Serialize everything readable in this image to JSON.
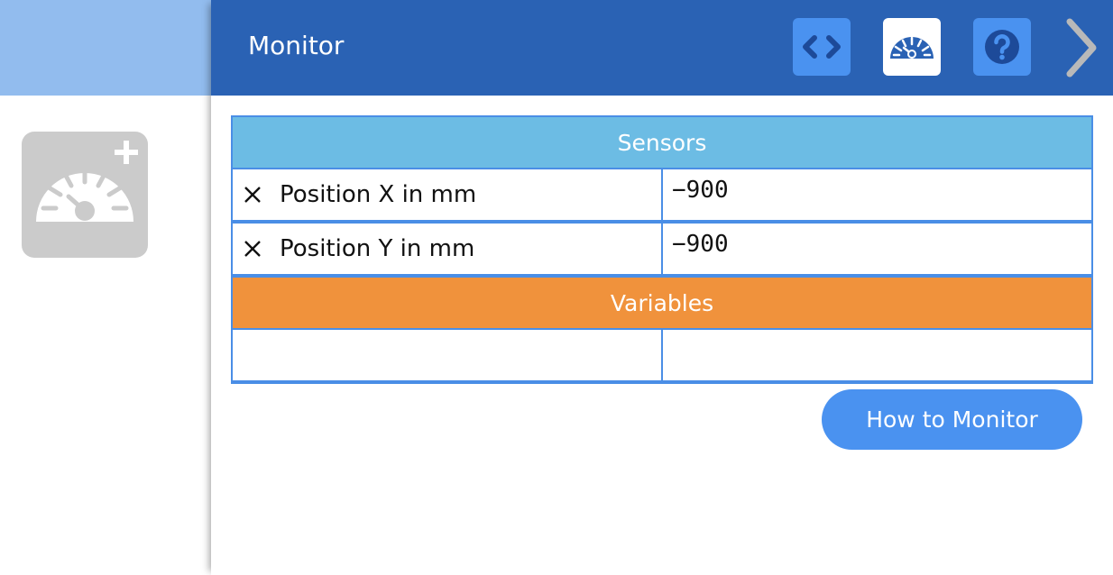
{
  "header": {
    "title": "Monitor"
  },
  "toolbar": {
    "code_icon": "code-brackets-icon",
    "monitor_icon": "gauge-icon",
    "help_icon": "question-icon",
    "next_icon": "chevron-right-icon"
  },
  "sidebar": {
    "add_monitor_icon": "gauge-add-icon"
  },
  "sensors": {
    "heading": "Sensors",
    "rows": [
      {
        "label": "Position X in mm",
        "value": "−900"
      },
      {
        "label": "Position Y in mm",
        "value": "−900"
      }
    ]
  },
  "variables": {
    "heading": "Variables",
    "rows": [
      {
        "label": "",
        "value": ""
      }
    ]
  },
  "help_button": {
    "label": "How to Monitor"
  },
  "colors": {
    "header_blue": "#2a62b4",
    "left_header": "#92bcee",
    "button_blue": "#4a92f0",
    "sensors_head": "#6cbce4",
    "variables_head": "#f0923c",
    "table_border": "#4a8ee6"
  }
}
